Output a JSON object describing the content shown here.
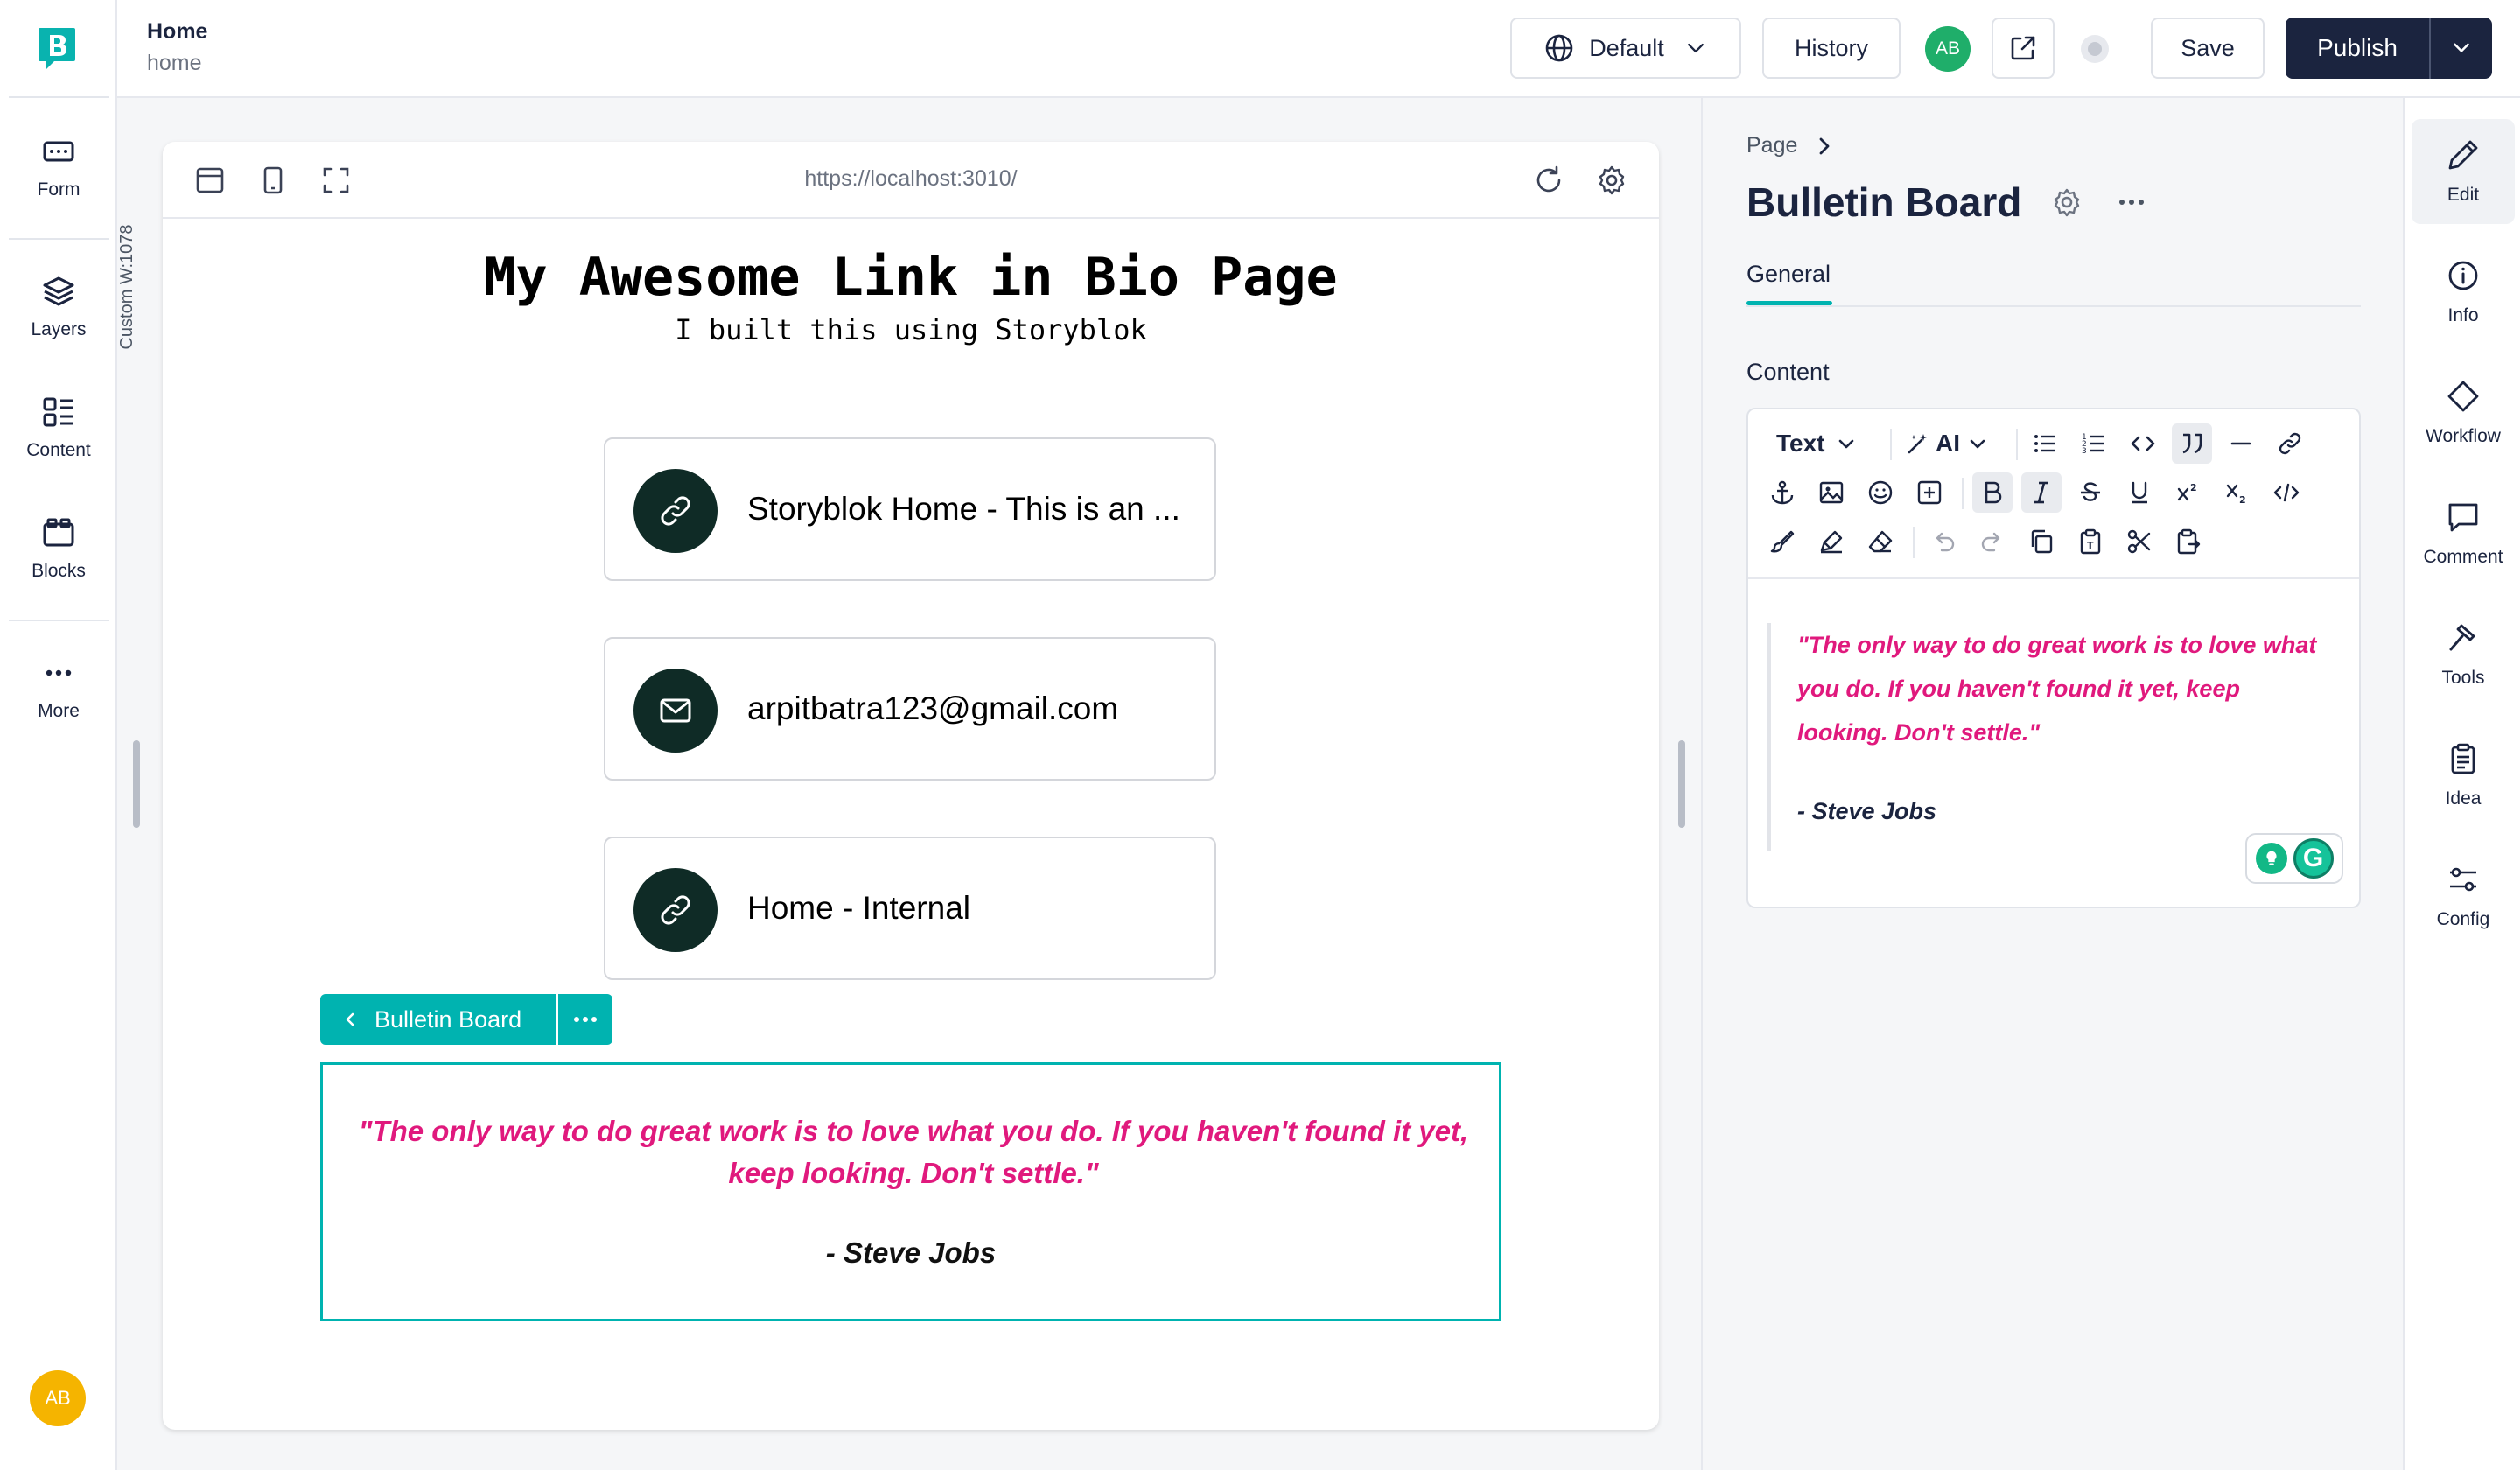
{
  "colors": {
    "accent": "#00b3b0",
    "primary_dark": "#1b243f",
    "quote_pink": "#e0197d",
    "avatar_green": "#1fae6a",
    "avatar_yellow": "#f5b400"
  },
  "left_rail": {
    "items": [
      {
        "label": "Form",
        "icon": "form-icon"
      },
      {
        "label": "Layers",
        "icon": "layers-icon"
      },
      {
        "label": "Content",
        "icon": "content-icon"
      },
      {
        "label": "Blocks",
        "icon": "blocks-icon"
      },
      {
        "label": "More",
        "icon": "more-dots-icon"
      }
    ],
    "user_initials": "AB"
  },
  "topbar": {
    "title": "Home",
    "slug": "home",
    "language_label": "Default",
    "history_label": "History",
    "user_initials": "AB",
    "save_label": "Save",
    "publish_label": "Publish"
  },
  "preview": {
    "viewport_label": "Custom W:1078",
    "url": "https://localhost:3010/",
    "page_title": "My Awesome Link in Bio Page",
    "page_subtitle": "I built this using Storyblok",
    "links": [
      {
        "text": "Storyblok Home - This is an ...",
        "icon": "link-icon"
      },
      {
        "text": "arpitbatra123@gmail.com",
        "icon": "mail-icon"
      },
      {
        "text": "Home - Internal",
        "icon": "link-icon"
      }
    ],
    "selected_block": {
      "name": "Bulletin Board",
      "quote": "\"The only way to do great work is to love what you do. If you haven't found it yet, keep looking. Don't settle.\"",
      "author": "- Steve Jobs"
    }
  },
  "right_panel": {
    "breadcrumb": "Page",
    "title": "Bulletin Board",
    "tab": "General",
    "field_label": "Content",
    "editor": {
      "format_label": "Text",
      "ai_label": "AI",
      "quote": "\"The only way to do great work is to love what you do. If you haven't found it yet, keep looking. Don't settle.\"",
      "author": "-  Steve Jobs"
    }
  },
  "right_rail": {
    "items": [
      {
        "label": "Edit",
        "icon": "pencil-icon"
      },
      {
        "label": "Info",
        "icon": "info-icon"
      },
      {
        "label": "Workflow",
        "icon": "workflow-icon"
      },
      {
        "label": "Comment",
        "icon": "comment-icon"
      },
      {
        "label": "Tools",
        "icon": "tools-icon"
      },
      {
        "label": "Idea",
        "icon": "idea-icon"
      },
      {
        "label": "Config",
        "icon": "config-icon"
      }
    ]
  }
}
